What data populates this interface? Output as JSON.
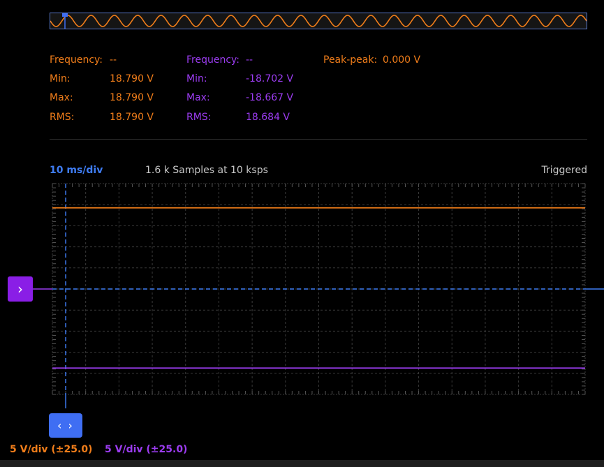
{
  "colors": {
    "ch1": "#f07d1a",
    "ch2": "#9b3cf0",
    "trigger": "#3f7df5",
    "grid": "#3a3a3a",
    "background": "#000000"
  },
  "measurements": {
    "ch1": {
      "frequency_label": "Frequency:",
      "frequency_value": "--",
      "min_label": "Min:",
      "min_value": "18.790 V",
      "max_label": "Max:",
      "max_value": "18.790 V",
      "rms_label": "RMS:",
      "rms_value": "18.790 V"
    },
    "ch2": {
      "frequency_label": "Frequency:",
      "frequency_value": "--",
      "min_label": "Min:",
      "min_value": "-18.702 V",
      "max_label": "Max:",
      "max_value": "-18.667 V",
      "rms_label": "RMS:",
      "rms_value": "18.684 V"
    },
    "peak_peak_label": "Peak-peak:",
    "peak_peak_value": "0.000 V"
  },
  "acquisition": {
    "timebase": "10 ms/div",
    "samples": "1.6 k Samples at 10 ksps",
    "status": "Triggered"
  },
  "traces": {
    "ch1_level_fraction": 0.115,
    "ch2_level_fraction": 0.875,
    "trigger_time_fraction": 0.025,
    "ch_offset_fraction": 0.5
  },
  "channel_marker": {
    "icon": "chevron-right-icon",
    "glyph": "›"
  },
  "time_marker": {
    "icon": "chevron-left-right-icon",
    "glyph": "‹ ›"
  },
  "scales": {
    "ch1": "5 V/div (±25.0)",
    "ch2": "5 V/div (±25.0)"
  }
}
